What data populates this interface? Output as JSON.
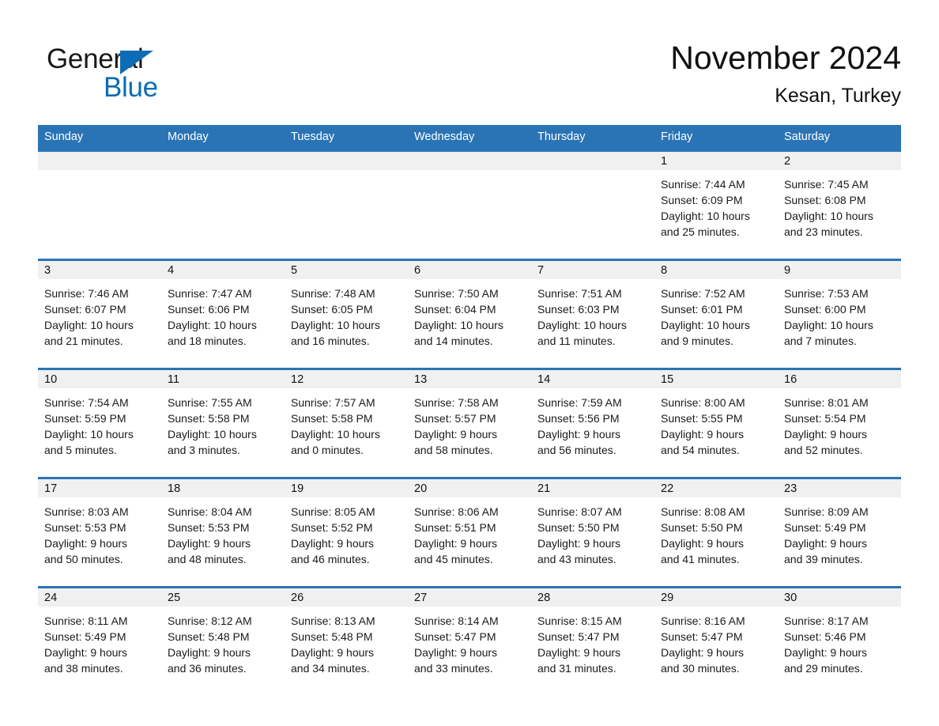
{
  "brand": {
    "line1": "General",
    "line2": "Blue",
    "triangle_icon": "brand-triangle-icon",
    "accent_color": "#0d6cb5"
  },
  "header": {
    "title": "November 2024",
    "subtitle": "Kesan, Turkey"
  },
  "calendar": {
    "header_color": "#2a74b6",
    "daynumber_bg": "#f0f0f0",
    "weekdays": [
      "Sunday",
      "Monday",
      "Tuesday",
      "Wednesday",
      "Thursday",
      "Friday",
      "Saturday"
    ],
    "weeks": [
      [
        {
          "day": "",
          "lines": []
        },
        {
          "day": "",
          "lines": []
        },
        {
          "day": "",
          "lines": []
        },
        {
          "day": "",
          "lines": []
        },
        {
          "day": "",
          "lines": []
        },
        {
          "day": "1",
          "lines": [
            "Sunrise: 7:44 AM",
            "Sunset: 6:09 PM",
            "Daylight: 10 hours",
            "and 25 minutes."
          ]
        },
        {
          "day": "2",
          "lines": [
            "Sunrise: 7:45 AM",
            "Sunset: 6:08 PM",
            "Daylight: 10 hours",
            "and 23 minutes."
          ]
        }
      ],
      [
        {
          "day": "3",
          "lines": [
            "Sunrise: 7:46 AM",
            "Sunset: 6:07 PM",
            "Daylight: 10 hours",
            "and 21 minutes."
          ]
        },
        {
          "day": "4",
          "lines": [
            "Sunrise: 7:47 AM",
            "Sunset: 6:06 PM",
            "Daylight: 10 hours",
            "and 18 minutes."
          ]
        },
        {
          "day": "5",
          "lines": [
            "Sunrise: 7:48 AM",
            "Sunset: 6:05 PM",
            "Daylight: 10 hours",
            "and 16 minutes."
          ]
        },
        {
          "day": "6",
          "lines": [
            "Sunrise: 7:50 AM",
            "Sunset: 6:04 PM",
            "Daylight: 10 hours",
            "and 14 minutes."
          ]
        },
        {
          "day": "7",
          "lines": [
            "Sunrise: 7:51 AM",
            "Sunset: 6:03 PM",
            "Daylight: 10 hours",
            "and 11 minutes."
          ]
        },
        {
          "day": "8",
          "lines": [
            "Sunrise: 7:52 AM",
            "Sunset: 6:01 PM",
            "Daylight: 10 hours",
            "and 9 minutes."
          ]
        },
        {
          "day": "9",
          "lines": [
            "Sunrise: 7:53 AM",
            "Sunset: 6:00 PM",
            "Daylight: 10 hours",
            "and 7 minutes."
          ]
        }
      ],
      [
        {
          "day": "10",
          "lines": [
            "Sunrise: 7:54 AM",
            "Sunset: 5:59 PM",
            "Daylight: 10 hours",
            "and 5 minutes."
          ]
        },
        {
          "day": "11",
          "lines": [
            "Sunrise: 7:55 AM",
            "Sunset: 5:58 PM",
            "Daylight: 10 hours",
            "and 3 minutes."
          ]
        },
        {
          "day": "12",
          "lines": [
            "Sunrise: 7:57 AM",
            "Sunset: 5:58 PM",
            "Daylight: 10 hours",
            "and 0 minutes."
          ]
        },
        {
          "day": "13",
          "lines": [
            "Sunrise: 7:58 AM",
            "Sunset: 5:57 PM",
            "Daylight: 9 hours",
            "and 58 minutes."
          ]
        },
        {
          "day": "14",
          "lines": [
            "Sunrise: 7:59 AM",
            "Sunset: 5:56 PM",
            "Daylight: 9 hours",
            "and 56 minutes."
          ]
        },
        {
          "day": "15",
          "lines": [
            "Sunrise: 8:00 AM",
            "Sunset: 5:55 PM",
            "Daylight: 9 hours",
            "and 54 minutes."
          ]
        },
        {
          "day": "16",
          "lines": [
            "Sunrise: 8:01 AM",
            "Sunset: 5:54 PM",
            "Daylight: 9 hours",
            "and 52 minutes."
          ]
        }
      ],
      [
        {
          "day": "17",
          "lines": [
            "Sunrise: 8:03 AM",
            "Sunset: 5:53 PM",
            "Daylight: 9 hours",
            "and 50 minutes."
          ]
        },
        {
          "day": "18",
          "lines": [
            "Sunrise: 8:04 AM",
            "Sunset: 5:53 PM",
            "Daylight: 9 hours",
            "and 48 minutes."
          ]
        },
        {
          "day": "19",
          "lines": [
            "Sunrise: 8:05 AM",
            "Sunset: 5:52 PM",
            "Daylight: 9 hours",
            "and 46 minutes."
          ]
        },
        {
          "day": "20",
          "lines": [
            "Sunrise: 8:06 AM",
            "Sunset: 5:51 PM",
            "Daylight: 9 hours",
            "and 45 minutes."
          ]
        },
        {
          "day": "21",
          "lines": [
            "Sunrise: 8:07 AM",
            "Sunset: 5:50 PM",
            "Daylight: 9 hours",
            "and 43 minutes."
          ]
        },
        {
          "day": "22",
          "lines": [
            "Sunrise: 8:08 AM",
            "Sunset: 5:50 PM",
            "Daylight: 9 hours",
            "and 41 minutes."
          ]
        },
        {
          "day": "23",
          "lines": [
            "Sunrise: 8:09 AM",
            "Sunset: 5:49 PM",
            "Daylight: 9 hours",
            "and 39 minutes."
          ]
        }
      ],
      [
        {
          "day": "24",
          "lines": [
            "Sunrise: 8:11 AM",
            "Sunset: 5:49 PM",
            "Daylight: 9 hours",
            "and 38 minutes."
          ]
        },
        {
          "day": "25",
          "lines": [
            "Sunrise: 8:12 AM",
            "Sunset: 5:48 PM",
            "Daylight: 9 hours",
            "and 36 minutes."
          ]
        },
        {
          "day": "26",
          "lines": [
            "Sunrise: 8:13 AM",
            "Sunset: 5:48 PM",
            "Daylight: 9 hours",
            "and 34 minutes."
          ]
        },
        {
          "day": "27",
          "lines": [
            "Sunrise: 8:14 AM",
            "Sunset: 5:47 PM",
            "Daylight: 9 hours",
            "and 33 minutes."
          ]
        },
        {
          "day": "28",
          "lines": [
            "Sunrise: 8:15 AM",
            "Sunset: 5:47 PM",
            "Daylight: 9 hours",
            "and 31 minutes."
          ]
        },
        {
          "day": "29",
          "lines": [
            "Sunrise: 8:16 AM",
            "Sunset: 5:47 PM",
            "Daylight: 9 hours",
            "and 30 minutes."
          ]
        },
        {
          "day": "30",
          "lines": [
            "Sunrise: 8:17 AM",
            "Sunset: 5:46 PM",
            "Daylight: 9 hours",
            "and 29 minutes."
          ]
        }
      ]
    ]
  }
}
